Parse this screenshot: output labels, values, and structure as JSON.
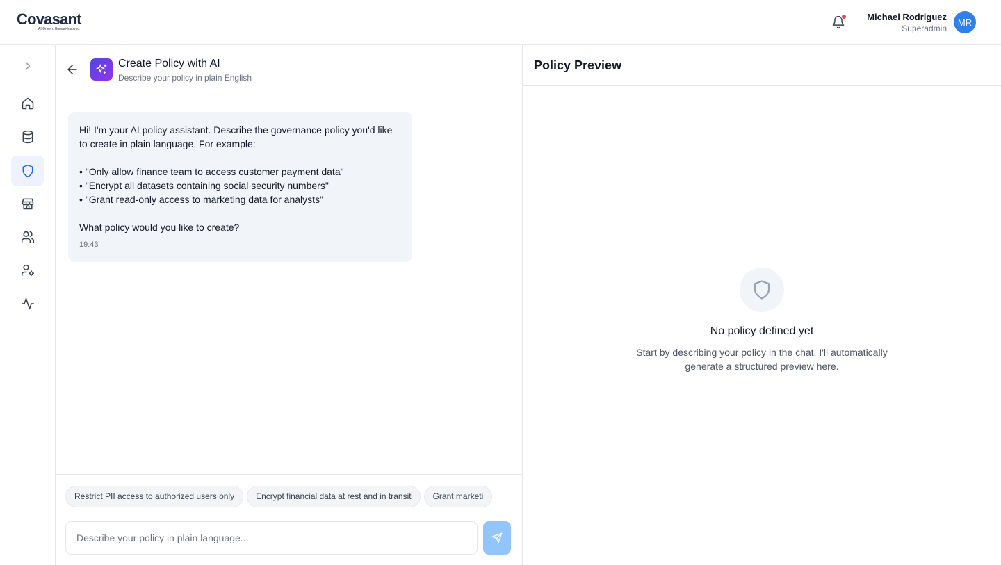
{
  "brand": {
    "name": "Covasant",
    "tagline": "AI-Driven. Human-Inspired."
  },
  "header": {
    "notification_icon": "bell-icon",
    "user_name": "Michael Rodriguez",
    "user_role": "Superadmin",
    "avatar_initials": "MR",
    "avatar_color": "#2f80ed"
  },
  "sidebar": {
    "items": [
      {
        "icon": "chevron-right-icon",
        "name": "expand"
      },
      {
        "icon": "home-icon",
        "name": "home"
      },
      {
        "icon": "database-icon",
        "name": "data"
      },
      {
        "icon": "shield-icon",
        "name": "policies",
        "active": true
      },
      {
        "icon": "store-icon",
        "name": "marketplace"
      },
      {
        "icon": "users-icon",
        "name": "users"
      },
      {
        "icon": "user-settings-icon",
        "name": "user-settings"
      },
      {
        "icon": "activity-icon",
        "name": "activity"
      }
    ]
  },
  "chat": {
    "title": "Create Policy with AI",
    "subtitle": "Describe your policy in plain English",
    "message": {
      "intro": "Hi! I'm your AI policy assistant. Describe the governance policy you'd like to create in plain language. For example:",
      "examples": [
        "• \"Only allow finance team to access customer payment data\"",
        "• \"Encrypt all datasets containing social security numbers\"",
        "• \"Grant read-only access to marketing data for analysts\""
      ],
      "question": "What policy would you like to create?",
      "time": "19:43"
    },
    "suggestions": [
      "Restrict PII access to authorized users only",
      "Encrypt financial data at rest and in transit",
      "Grant marketi"
    ],
    "input_placeholder": "Describe your policy in plain language..."
  },
  "preview": {
    "title": "Policy Preview",
    "empty_title": "No policy defined yet",
    "empty_text": "Start by describing your policy in the chat. I'll automatically generate a structured preview here."
  },
  "colors": {
    "accent": "#2563eb",
    "send_disabled": "#93c5fd",
    "ai_gradient_start": "#4f46e5",
    "ai_gradient_end": "#9333ea",
    "notification_dot": "#ef4444"
  }
}
